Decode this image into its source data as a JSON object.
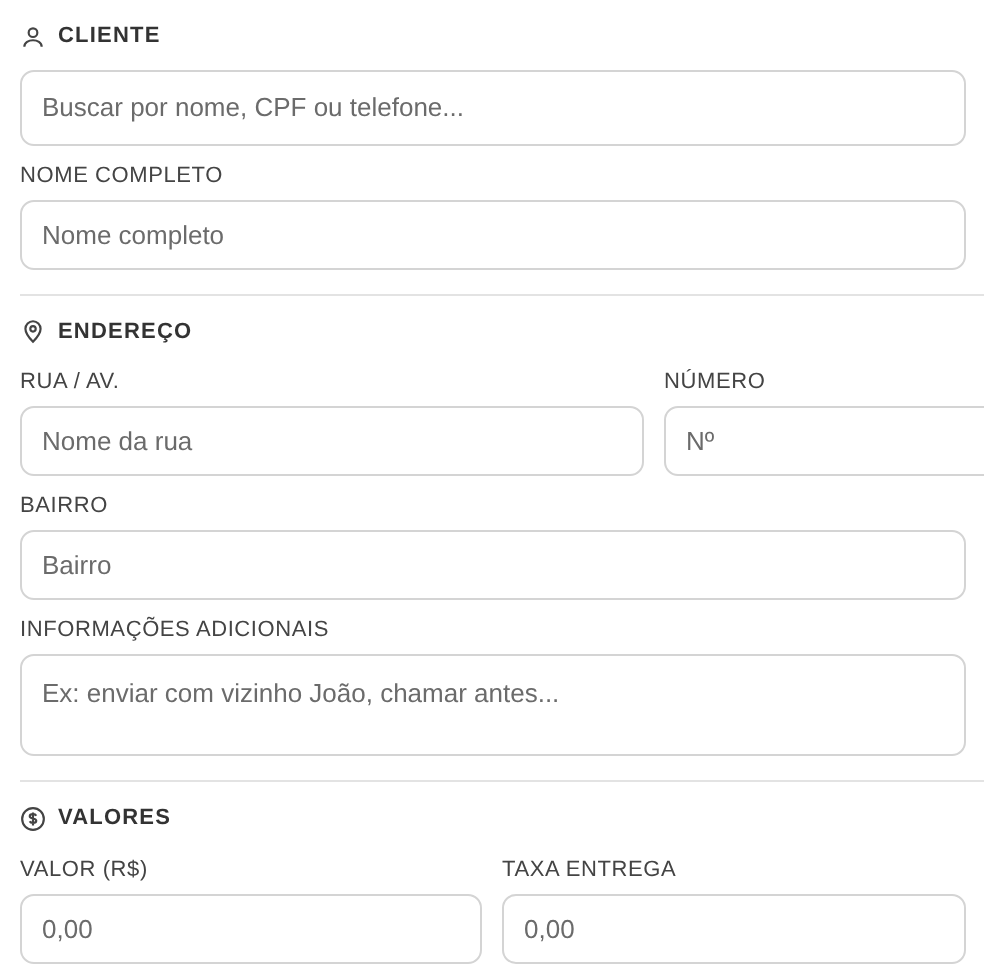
{
  "sections": [
    {
      "title": "CLIENTE",
      "kind": "user",
      "rows": [
        [
          {
            "kind": "search",
            "placeholder": "Buscar por nome, CPF ou telefone..."
          }
        ],
        [
          {
            "kind": "input",
            "label": "NOME COMPLETO",
            "placeholder": "Nome completo"
          }
        ]
      ]
    },
    {
      "title": "ENDEREÇO",
      "kind": "pin",
      "rows": [
        [
          {
            "kind": "input",
            "label": "RUA / AV.",
            "placeholder": "Nome da rua"
          },
          {
            "kind": "input",
            "label": "NÚMERO",
            "placeholder": "Nº"
          }
        ],
        [
          {
            "kind": "input",
            "label": "BAIRRO",
            "placeholder": "Bairro"
          }
        ],
        [
          {
            "kind": "textarea",
            "label": "INFORMAÇÕES ADICIONAIS",
            "placeholder": "Ex: enviar com vizinho João, chamar antes..."
          }
        ]
      ]
    },
    {
      "title": "VALORES",
      "kind": "dollar",
      "rows": [
        [
          {
            "kind": "input",
            "label": "VALOR (R$)",
            "placeholder": "0,00"
          },
          {
            "kind": "input",
            "label": "TAXA ENTREGA",
            "placeholder": "0,00"
          }
        ]
      ]
    }
  ]
}
